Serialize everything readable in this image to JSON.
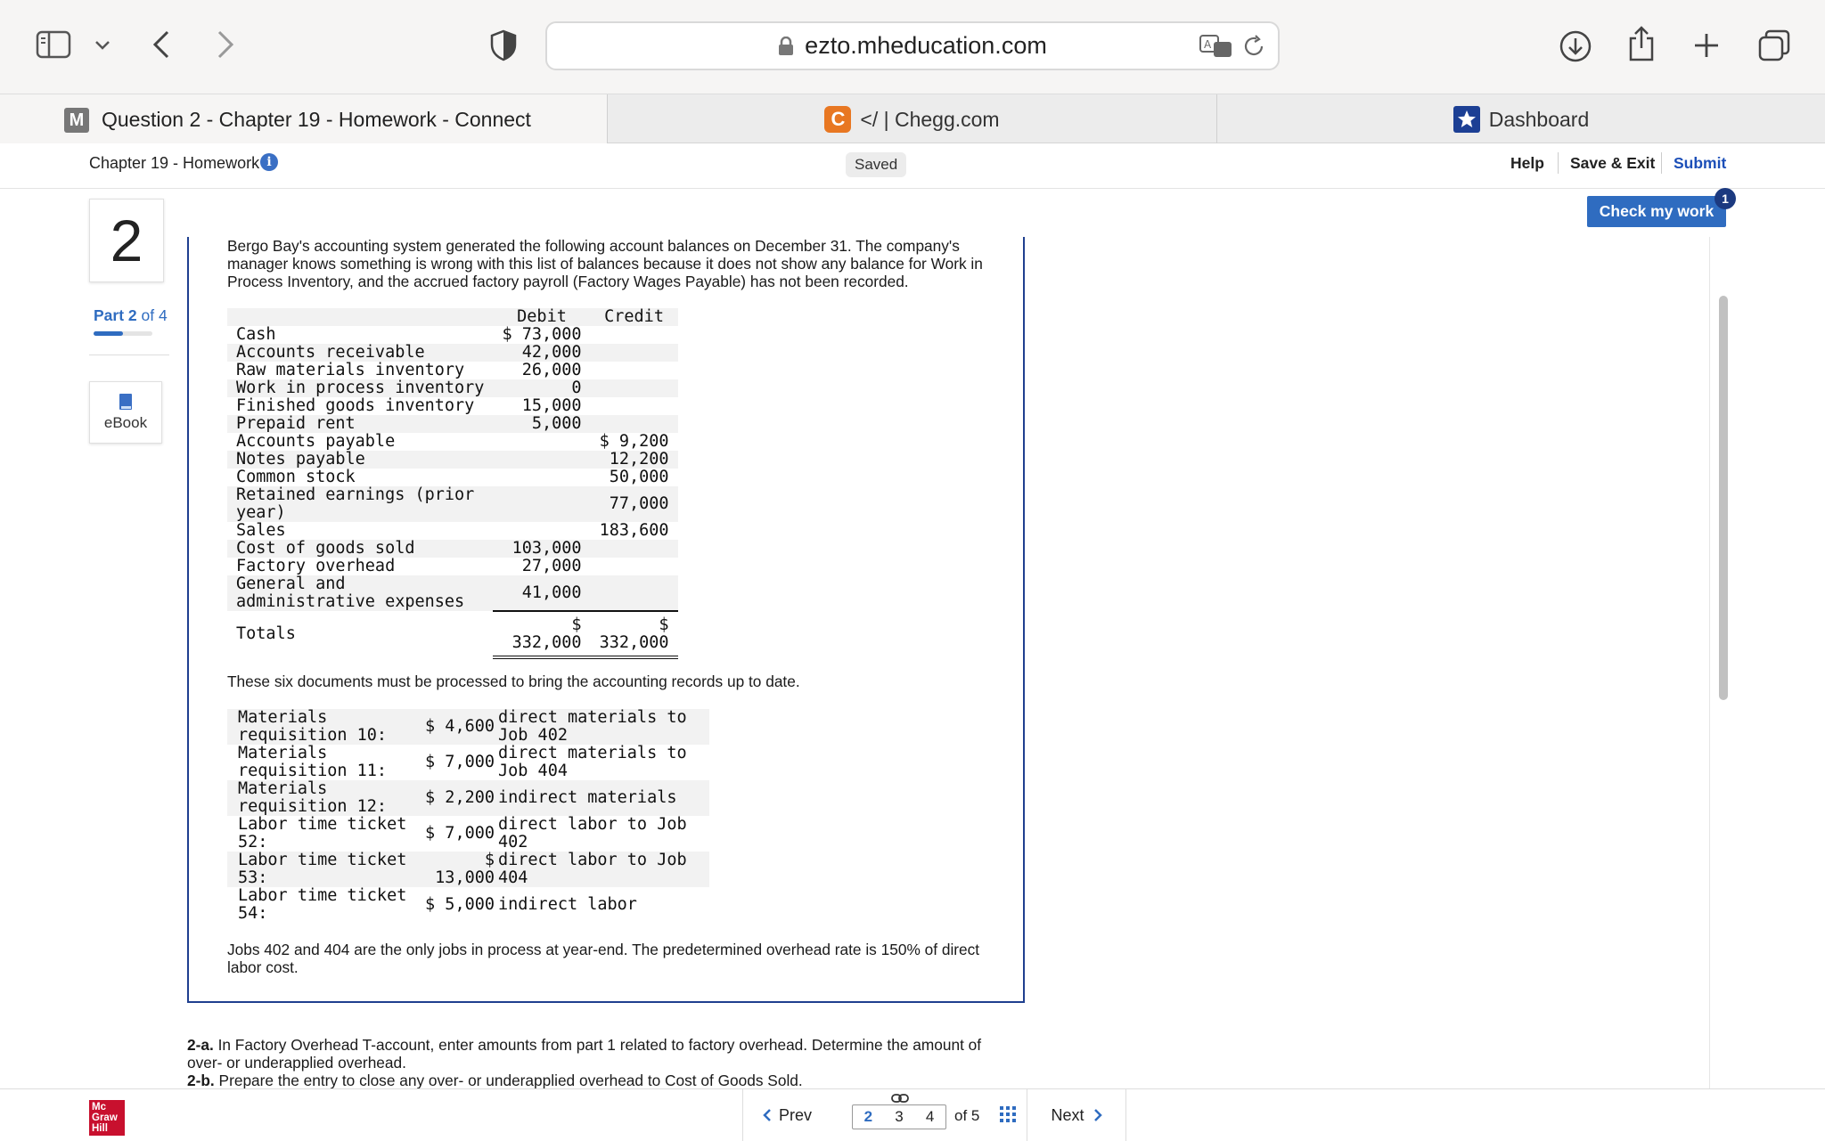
{
  "browser": {
    "url": "ezto.mheducation.com",
    "tabs": [
      {
        "label": "Question 2 - Chapter 19 - Homework - Connect",
        "favicon": "M"
      },
      {
        "label": "</ | Chegg.com",
        "favicon": "C"
      },
      {
        "label": "Dashboard",
        "favicon": "star"
      }
    ]
  },
  "header": {
    "title": "Chapter 19 - Homework",
    "status": "Saved",
    "help": "Help",
    "save_exit": "Save & Exit",
    "submit": "Submit",
    "check": "Check my work",
    "check_badge": "1"
  },
  "sidebar": {
    "question_number": "2",
    "part_label": "Part",
    "part_number": "2",
    "part_of": "of 4",
    "ebook": "eBook"
  },
  "question": {
    "intro": "Bergo Bay's accounting system generated the following account balances on December 31. The company's manager knows something is wrong with this list of balances because it does not show any balance for Work in Process Inventory, and the accrued factory payroll (Factory Wages Payable) has not been recorded.",
    "table_headers": {
      "debit": "Debit",
      "credit": "Credit"
    },
    "accounts": [
      {
        "name": "Cash",
        "debit": "$ 73,000",
        "credit": ""
      },
      {
        "name": "Accounts receivable",
        "debit": "42,000",
        "credit": ""
      },
      {
        "name": "Raw materials inventory",
        "debit": "26,000",
        "credit": ""
      },
      {
        "name": "Work in process inventory",
        "debit": "0",
        "credit": ""
      },
      {
        "name": "Finished goods inventory",
        "debit": "15,000",
        "credit": ""
      },
      {
        "name": "Prepaid rent",
        "debit": "5,000",
        "credit": ""
      },
      {
        "name": "Accounts payable",
        "debit": "",
        "credit": "$ 9,200"
      },
      {
        "name": "Notes payable",
        "debit": "",
        "credit": "12,200"
      },
      {
        "name": "Common stock",
        "debit": "",
        "credit": "50,000"
      },
      {
        "name": "Retained earnings (prior year)",
        "debit": "",
        "credit": "77,000"
      },
      {
        "name": "Sales",
        "debit": "",
        "credit": "183,600"
      },
      {
        "name": "Cost of goods sold",
        "debit": "103,000",
        "credit": ""
      },
      {
        "name": "Factory overhead",
        "debit": "27,000",
        "credit": ""
      },
      {
        "name": "General and administrative expenses",
        "debit": "41,000",
        "credit": ""
      }
    ],
    "totals": {
      "label": "Totals",
      "debit": "$ 332,000",
      "credit": "$ 332,000"
    },
    "docs_intro": "These six documents must be processed to bring the accounting records up to date.",
    "documents": [
      {
        "name": "Materials requisition 10:",
        "amount": "$ 4,600",
        "desc": "direct materials to Job 402"
      },
      {
        "name": "Materials requisition 11:",
        "amount": "$ 7,000",
        "desc": "direct materials to Job 404"
      },
      {
        "name": "Materials requisition 12:",
        "amount": "$ 2,200",
        "desc": "indirect materials"
      },
      {
        "name": "Labor time ticket 52:",
        "amount": "$ 7,000",
        "desc": "direct labor to Job 402"
      },
      {
        "name": "Labor time ticket 53:",
        "amount": "$ 13,000",
        "desc": "direct labor to Job 404"
      },
      {
        "name": "Labor time ticket 54:",
        "amount": "$ 5,000",
        "desc": "indirect labor"
      }
    ],
    "closing": "Jobs 402 and 404 are the only jobs in process at year-end. The predetermined overhead rate is 150% of direct labor cost.",
    "part_a_label": "2-a.",
    "part_a": "In Factory Overhead T-account, enter amounts from part 1 related to factory overhead. Determine the amount of over- or underapplied overhead.",
    "part_b_label": "2-b.",
    "part_b": "Prepare the entry to close any over- or underapplied overhead to Cost of Goods Sold."
  },
  "footer": {
    "logo": [
      "Mc",
      "Graw",
      "Hill"
    ],
    "prev": "Prev",
    "pages": [
      "2",
      "3",
      "4"
    ],
    "of": "of 5",
    "next": "Next"
  }
}
